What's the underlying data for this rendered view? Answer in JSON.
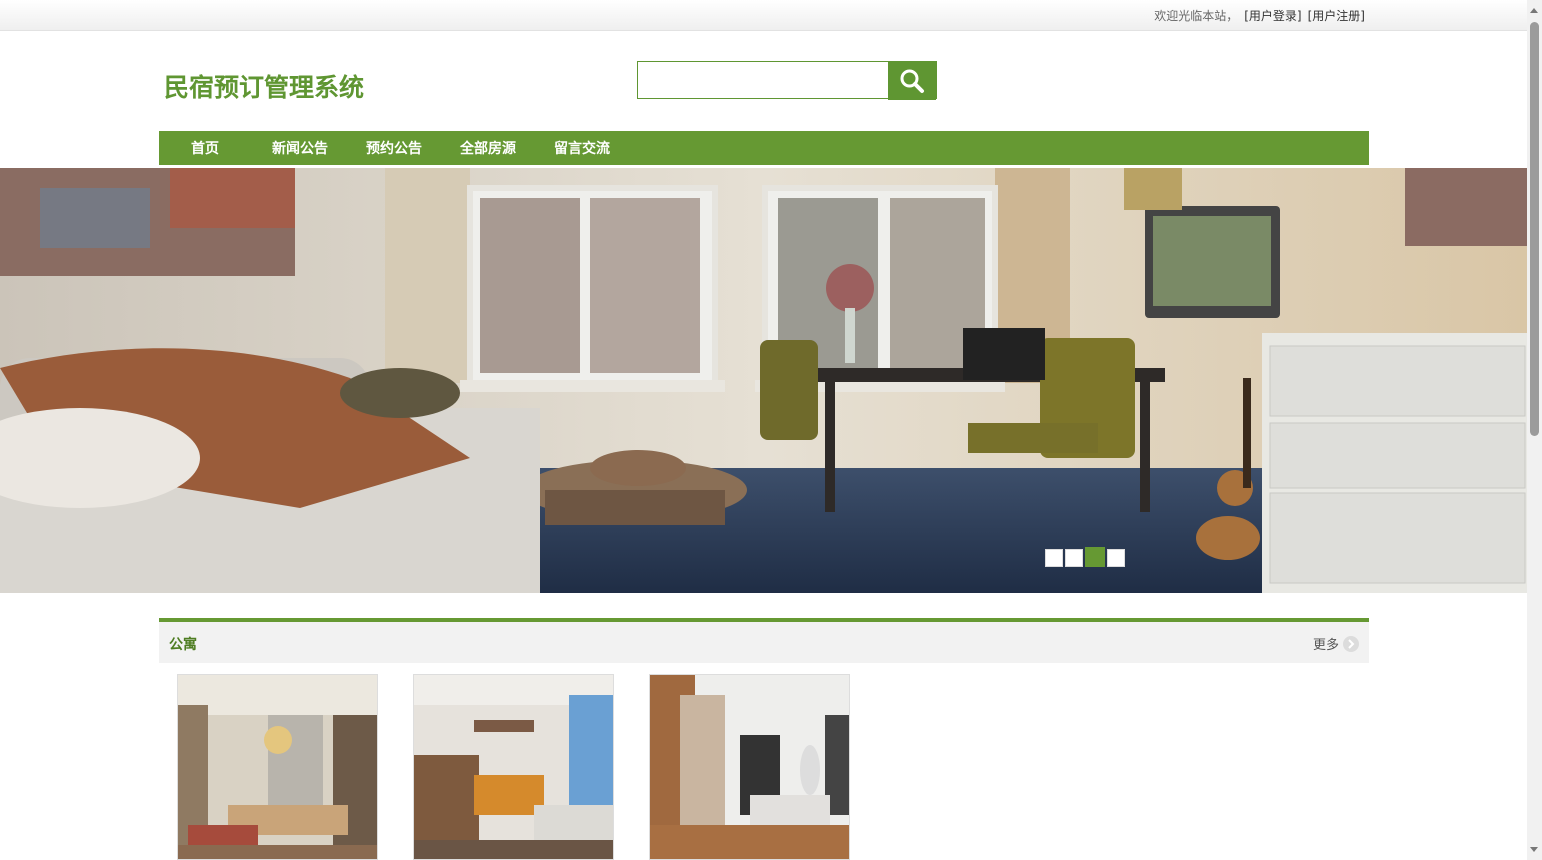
{
  "topbar": {
    "welcome": "欢迎光临本站，",
    "login": "[用户登录]",
    "register": "[用户注册]"
  },
  "header": {
    "title": "民宿预订管理系统",
    "search": {
      "placeholder": "",
      "value": ""
    }
  },
  "nav": {
    "items": [
      {
        "label": "首页"
      },
      {
        "label": "新闻公告"
      },
      {
        "label": "预约公告"
      },
      {
        "label": "全部房源"
      },
      {
        "label": "留言交流"
      }
    ]
  },
  "banner": {
    "slides": 4,
    "active_slide": 3
  },
  "section": {
    "title": "公寓",
    "more": "更多"
  },
  "colors": {
    "brand_green": "#669933",
    "title_green": "#5f9632"
  }
}
